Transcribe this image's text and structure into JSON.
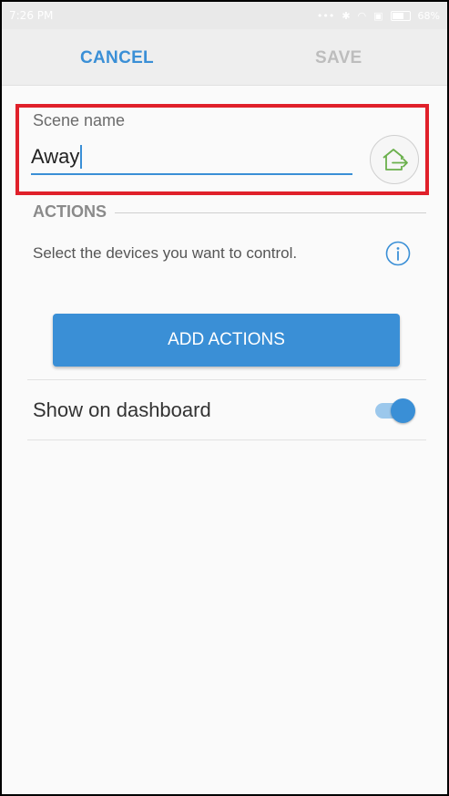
{
  "status_bar": {
    "time": "7:26 PM",
    "battery": "68%",
    "battery_level": 0.68,
    "icons": [
      "more-icon",
      "bluetooth-icon",
      "wifi-icon",
      "sim-icon",
      "battery-icon"
    ]
  },
  "toolbar": {
    "cancel_label": "CANCEL",
    "save_label": "SAVE"
  },
  "scene": {
    "label": "Scene name",
    "value": "Away",
    "icon": "home-exit-icon"
  },
  "actions": {
    "header": "ACTIONS",
    "description": "Select the devices you want to control.",
    "add_button": "ADD ACTIONS"
  },
  "dashboard": {
    "label": "Show on dashboard",
    "enabled": true
  },
  "colors": {
    "accent": "#3a8fd6",
    "highlight": "#e0202a",
    "icon_green": "#6ab04c",
    "disabled": "#bdbdbd"
  }
}
